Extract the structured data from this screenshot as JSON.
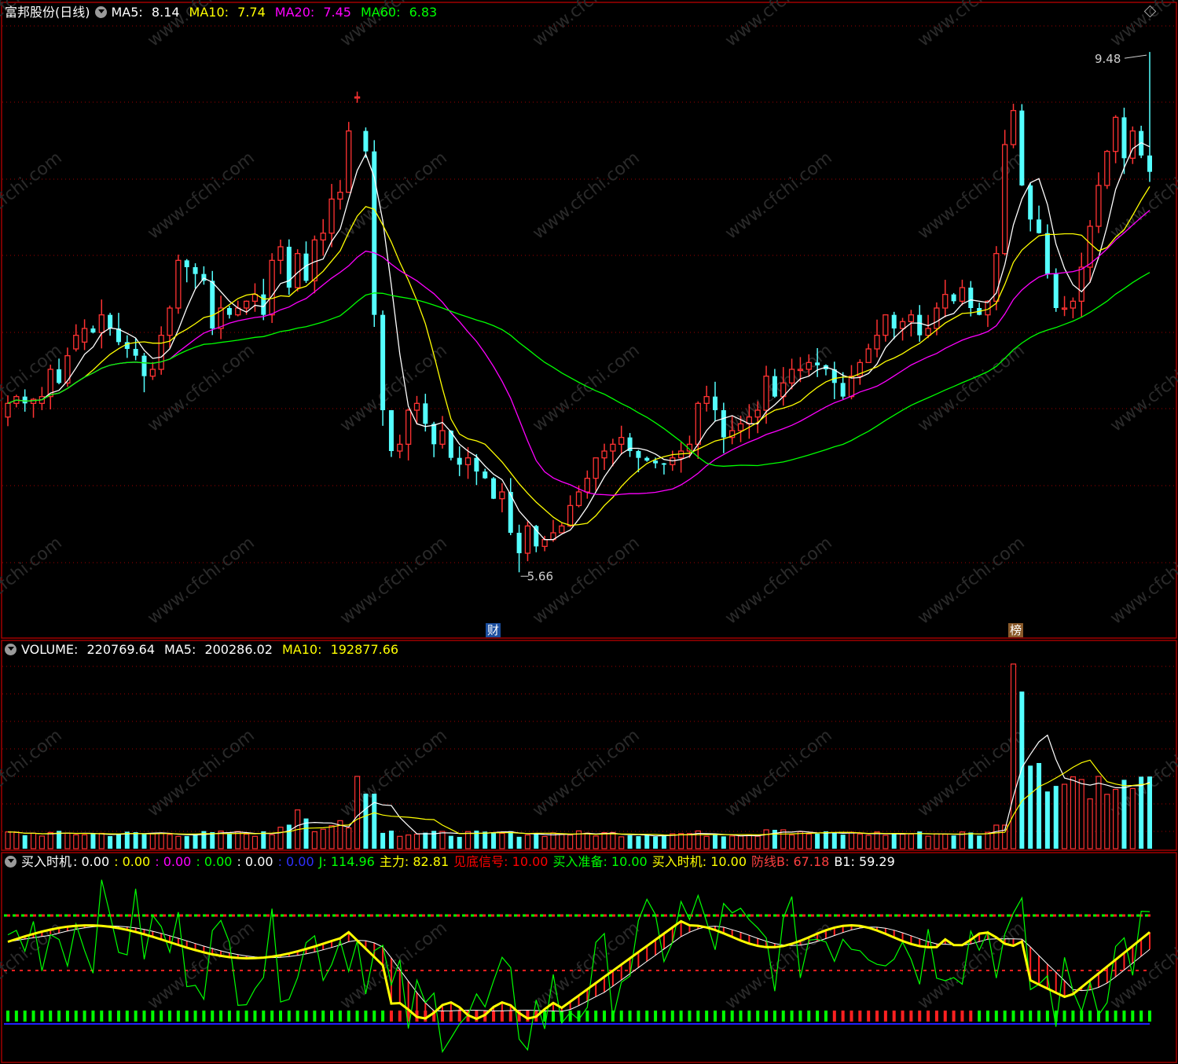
{
  "header_main": {
    "stock": "富邦股份(日线)",
    "ma5": {
      "label": "MA5:",
      "value": "8.14",
      "color": "#ffffff"
    },
    "ma10": {
      "label": "MA10:",
      "value": "7.74",
      "color": "#ffff00"
    },
    "ma20": {
      "label": "MA20:",
      "value": "7.45",
      "color": "#ff00ff"
    },
    "ma60": {
      "label": "MA60:",
      "value": "6.83",
      "color": "#00ff00"
    }
  },
  "header_vol": {
    "vol": {
      "label": "VOLUME:",
      "value": "220769.64"
    },
    "ma5": {
      "label": "MA5:",
      "value": "200286.02"
    },
    "ma10": {
      "label": "MA10:",
      "value": "192877.66"
    }
  },
  "header_ind": {
    "name": "买入时机",
    "zeros": [
      {
        "text": ": 0.00",
        "color": "#ffffff"
      },
      {
        "text": ": 0.00",
        "color": "#ffff00"
      },
      {
        "text": ": 0.00",
        "color": "#ff00ff"
      },
      {
        "text": ": 0.00",
        "color": "#00ff00"
      },
      {
        "text": ": 0.00",
        "color": "#ffffff"
      },
      {
        "text": ": 0.00",
        "color": "#3030ff"
      }
    ],
    "j": {
      "text": "J: 114.96",
      "color": "#00ff00"
    },
    "zhuli": {
      "text": "主力: 82.81",
      "color": "#ffff00"
    },
    "jiandi": {
      "text": "见底信号: 10.00",
      "color": "#ff0000"
    },
    "zhunbei": {
      "text": "买入准备: 10.00",
      "color": "#00ff00"
    },
    "shiji": {
      "text": "买入时机: 10.00",
      "color": "#ffff00"
    },
    "fangxian": {
      "text": "防线B: 67.18",
      "color": "#ff4040"
    },
    "b1": {
      "text": "B1: 59.29",
      "color": "#ffffff"
    }
  },
  "annotations": {
    "high_price": "9.48",
    "low_price": "5.66",
    "tag_cai": "财",
    "tag_bang": "榜"
  },
  "watermark": "www.cfchi.com",
  "chart_data": {
    "type": "candlestick",
    "price_range": [
      5.2,
      9.7
    ],
    "close": [
      6.9,
      6.95,
      6.9,
      6.93,
      6.95,
      7.15,
      7.05,
      7.25,
      7.4,
      7.45,
      7.42,
      7.55,
      7.45,
      7.35,
      7.3,
      7.25,
      7.1,
      7.15,
      7.4,
      7.6,
      7.95,
      7.9,
      7.85,
      7.8,
      7.45,
      7.6,
      7.55,
      7.6,
      7.65,
      7.7,
      7.55,
      7.95,
      8.05,
      7.75,
      8.0,
      7.8,
      8.1,
      8.15,
      8.4,
      8.45,
      8.9,
      9.15,
      8.75,
      7.55,
      6.85,
      6.55,
      6.6,
      6.85,
      6.9,
      6.75,
      6.6,
      6.7,
      6.5,
      6.45,
      6.5,
      6.4,
      6.35,
      6.2,
      6.25,
      5.95,
      5.8,
      6.0,
      5.85,
      5.9,
      5.95,
      6.0,
      6.15,
      6.25,
      6.35,
      6.5,
      6.55,
      6.6,
      6.65,
      6.55,
      6.5,
      6.48,
      6.46,
      6.45,
      6.5,
      6.55,
      6.6,
      6.9,
      6.95,
      6.85,
      6.65,
      6.7,
      6.75,
      6.8,
      6.85,
      7.1,
      6.95,
      7.05,
      7.15,
      7.15,
      7.2,
      7.18,
      7.15,
      7.05,
      6.95,
      7.1,
      7.2,
      7.3,
      7.4,
      7.55,
      7.45,
      7.5,
      7.55,
      7.4,
      7.45,
      7.6,
      7.7,
      7.65,
      7.75,
      7.6,
      7.55,
      7.65,
      8.0,
      8.8,
      9.05,
      8.5,
      8.25,
      8.15,
      7.85,
      7.6,
      7.6,
      7.65,
      7.9,
      8.2,
      8.5,
      8.75,
      9.0,
      8.7,
      8.9,
      8.72,
      8.6
    ],
    "open": [
      6.8,
      6.9,
      6.95,
      6.9,
      6.9,
      6.95,
      7.15,
      7.05,
      7.3,
      7.35,
      7.45,
      7.42,
      7.55,
      7.45,
      7.35,
      7.3,
      7.25,
      7.1,
      7.15,
      7.4,
      7.6,
      7.95,
      7.9,
      7.85,
      7.8,
      7.45,
      7.6,
      7.55,
      7.6,
      7.65,
      7.7,
      7.55,
      7.95,
      8.05,
      7.75,
      8.0,
      7.8,
      8.1,
      8.15,
      8.4,
      8.45,
      9.15,
      8.9,
      8.75,
      7.55,
      6.85,
      6.55,
      6.6,
      6.85,
      6.9,
      6.75,
      6.6,
      6.7,
      6.5,
      6.45,
      6.5,
      6.4,
      6.35,
      6.2,
      6.25,
      5.95,
      5.8,
      6.0,
      5.85,
      5.9,
      5.95,
      6.0,
      6.15,
      6.25,
      6.35,
      6.5,
      6.55,
      6.6,
      6.65,
      6.55,
      6.5,
      6.48,
      6.46,
      6.45,
      6.5,
      6.55,
      6.6,
      6.9,
      6.95,
      6.85,
      6.65,
      6.7,
      6.75,
      6.8,
      6.85,
      7.1,
      6.95,
      7.05,
      7.15,
      7.15,
      7.2,
      7.18,
      7.15,
      7.05,
      6.95,
      7.1,
      7.2,
      7.3,
      7.4,
      7.55,
      7.45,
      7.5,
      7.55,
      7.4,
      7.45,
      7.6,
      7.7,
      7.65,
      7.75,
      7.6,
      7.55,
      7.65,
      8.0,
      8.8,
      9.05,
      8.5,
      8.25,
      8.15,
      7.85,
      7.6,
      7.6,
      7.65,
      7.9,
      8.2,
      8.5,
      8.75,
      9.0,
      8.7,
      8.9,
      8.72
    ]
  }
}
